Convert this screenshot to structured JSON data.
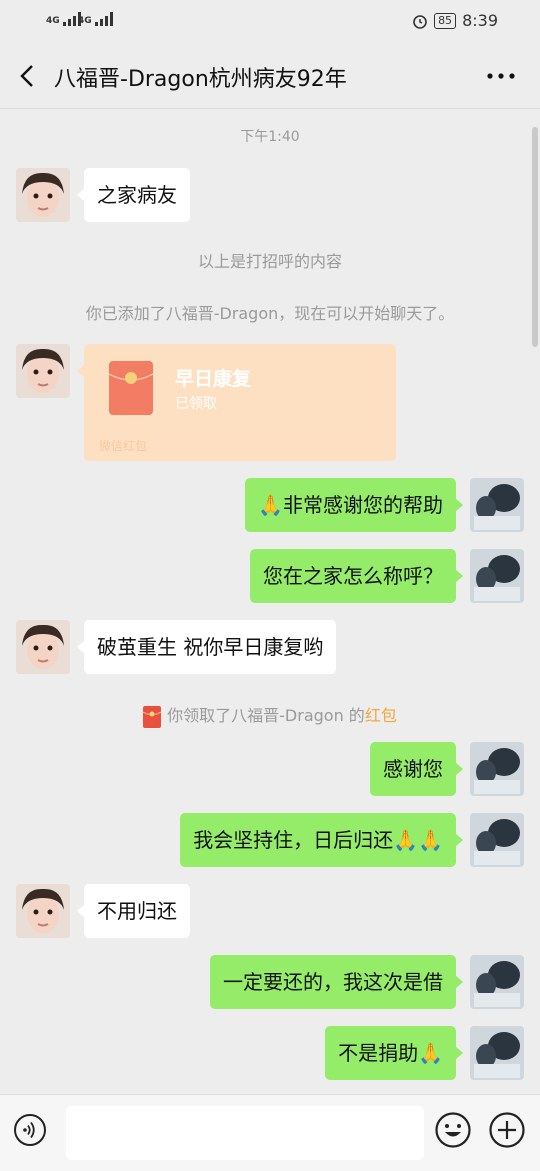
{
  "status_bar": {
    "signal_1": "4G",
    "signal_2": "4G",
    "battery": "85",
    "time": "8:39"
  },
  "header": {
    "title": "八福晋-Dragon杭州病友92年"
  },
  "messages": {
    "time_stamp": "下午1:40",
    "m1": "之家病友",
    "sys_greeting": "以上是打招呼的内容",
    "sys_added": "你已添加了八福晋-Dragon，现在可以开始聊天了。",
    "red_packet": {
      "title": "早日康复",
      "status": "已领取",
      "footer": "微信红包"
    },
    "m2": "🙏非常感谢您的帮助",
    "m3": "您在之家怎么称呼？",
    "m4": "破茧重生 祝你早日康复哟",
    "rp_notice": {
      "text": "你领取了八福晋-Dragon 的",
      "link": "红包"
    },
    "m5": "感谢您",
    "m6": "我会坚持住，日后归还🙏🙏",
    "m7": "不用归还",
    "m8": "一定要还的，我这次是借",
    "m9": "不是捐助🙏"
  },
  "colors": {
    "bg": "#ededed",
    "outgoing": "#95ec69",
    "incoming": "#ffffff",
    "red_packet": "#fde0c2",
    "highlight": "#f5a83d"
  },
  "icons": [
    "back-icon",
    "more-icon",
    "voice-icon",
    "emoji-icon",
    "plus-icon",
    "red-packet-icon"
  ]
}
